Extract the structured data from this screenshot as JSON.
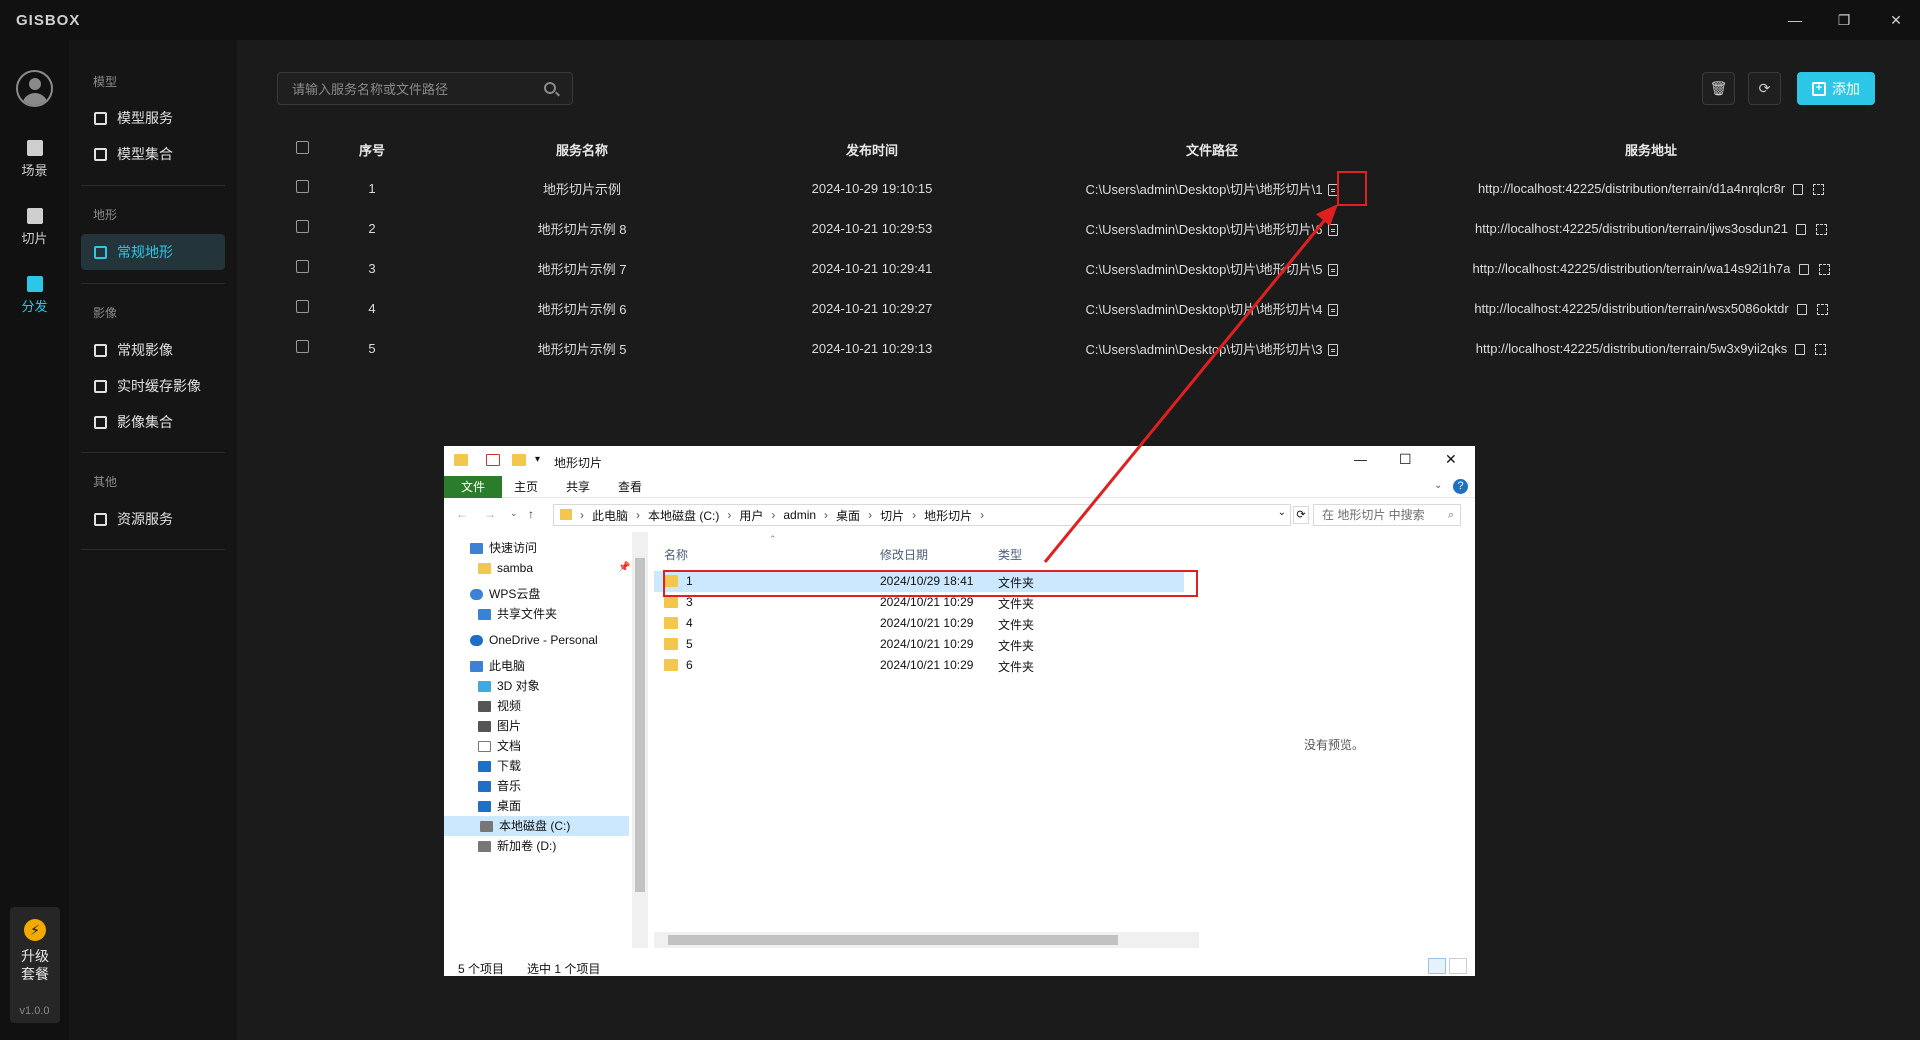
{
  "app": {
    "logo": "GISBOX",
    "version": "v1.0.0"
  },
  "window_controls": {
    "minimize": "—",
    "restore": "❐",
    "close": "✕"
  },
  "rail": {
    "items": [
      {
        "label": "场景",
        "icon": "home-icon",
        "active": false
      },
      {
        "label": "切片",
        "icon": "slice-icon",
        "active": false
      },
      {
        "label": "分发",
        "icon": "distribute-icon",
        "active": true
      }
    ],
    "upgrade": {
      "line1": "升级",
      "line2": "套餐",
      "icon": "⚡"
    }
  },
  "nav": {
    "groups": [
      {
        "title": "模型",
        "items": [
          "模型服务",
          "模型集合"
        ]
      },
      {
        "title": "地形",
        "items": [
          "常规地形"
        ]
      },
      {
        "title": "影像",
        "items": [
          "常规影像",
          "实时缓存影像",
          "影像集合"
        ]
      },
      {
        "title": "其他",
        "items": [
          "资源服务"
        ]
      }
    ],
    "active_item": "常规地形"
  },
  "toolbar": {
    "search_placeholder": "请输入服务名称或文件路径",
    "delete_icon": "🗑",
    "refresh_icon": "⟳",
    "add_label": "添加"
  },
  "table": {
    "headers": [
      "序号",
      "服务名称",
      "发布时间",
      "文件路径",
      "服务地址"
    ],
    "rows": [
      {
        "no": "1",
        "name": "地形切片示例",
        "time": "2024-10-29 19:10:15",
        "path": "C:\\Users\\admin\\Desktop\\切片\\地形切片\\1",
        "url": "http://localhost:42225/distribution/terrain/d1a4nrqlcr8r"
      },
      {
        "no": "2",
        "name": "地形切片示例 8",
        "time": "2024-10-21 10:29:53",
        "path": "C:\\Users\\admin\\Desktop\\切片\\地形切片\\6",
        "url": "http://localhost:42225/distribution/terrain/ijws3osdun21"
      },
      {
        "no": "3",
        "name": "地形切片示例 7",
        "time": "2024-10-21 10:29:41",
        "path": "C:\\Users\\admin\\Desktop\\切片\\地形切片\\5",
        "url": "http://localhost:42225/distribution/terrain/wa14s92i1h7a"
      },
      {
        "no": "4",
        "name": "地形切片示例 6",
        "time": "2024-10-21 10:29:27",
        "path": "C:\\Users\\admin\\Desktop\\切片\\地形切片\\4",
        "url": "http://localhost:42225/distribution/terrain/wsx5086oktdr"
      },
      {
        "no": "5",
        "name": "地形切片示例 5",
        "time": "2024-10-21 10:29:13",
        "path": "C:\\Users\\admin\\Desktop\\切片\\地形切片\\3",
        "url": "http://localhost:42225/distribution/terrain/5w3x9yii2qks"
      }
    ]
  },
  "explorer": {
    "title": "地形切片",
    "controls": {
      "minimize": "—",
      "maximize": "☐",
      "close": "✕"
    },
    "ribbon_tabs": [
      "文件",
      "主页",
      "共享",
      "查看"
    ],
    "breadcrumb": [
      "此电脑",
      "本地磁盘 (C:)",
      "用户",
      "admin",
      "桌面",
      "切片",
      "地形切片"
    ],
    "search_placeholder": "在 地形切片 中搜索",
    "tree": [
      {
        "label": "快速访问",
        "color": "#3b82d6"
      },
      {
        "label": "samba",
        "color": "#f3c64d"
      },
      {
        "label": "WPS云盘",
        "color": "#3b82d6"
      },
      {
        "label": "共享文件夹",
        "color": "#3b82d6"
      },
      {
        "label": "OneDrive - Personal",
        "color": "#1f6fc4"
      },
      {
        "label": "此电脑",
        "color": "#3b82d6"
      },
      {
        "label": "3D 对象",
        "color": "#3fa9e0"
      },
      {
        "label": "视频",
        "color": "#555555"
      },
      {
        "label": "图片",
        "color": "#555555"
      },
      {
        "label": "文档",
        "color": "#777777"
      },
      {
        "label": "下载",
        "color": "#1f6fc4"
      },
      {
        "label": "音乐",
        "color": "#1f6fc4"
      },
      {
        "label": "桌面",
        "color": "#1f6fc4"
      },
      {
        "label": "本地磁盘 (C:)",
        "color": "#777777"
      },
      {
        "label": "新加卷 (D:)",
        "color": "#777777"
      }
    ],
    "columns": [
      "名称",
      "修改日期",
      "类型"
    ],
    "files": [
      {
        "name": "1",
        "date": "2024/10/29 18:41",
        "type": "文件夹"
      },
      {
        "name": "3",
        "date": "2024/10/21 10:29",
        "type": "文件夹"
      },
      {
        "name": "4",
        "date": "2024/10/21 10:29",
        "type": "文件夹"
      },
      {
        "name": "5",
        "date": "2024/10/21 10:29",
        "type": "文件夹"
      },
      {
        "name": "6",
        "date": "2024/10/21 10:29",
        "type": "文件夹"
      }
    ],
    "preview_text": "没有预览。",
    "status_count": "5 个项目",
    "status_selected": "选中 1 个项目"
  },
  "colors": {
    "accent": "#2cc7e6",
    "highlight": "#e02020",
    "background": "#1b1b1b"
  }
}
